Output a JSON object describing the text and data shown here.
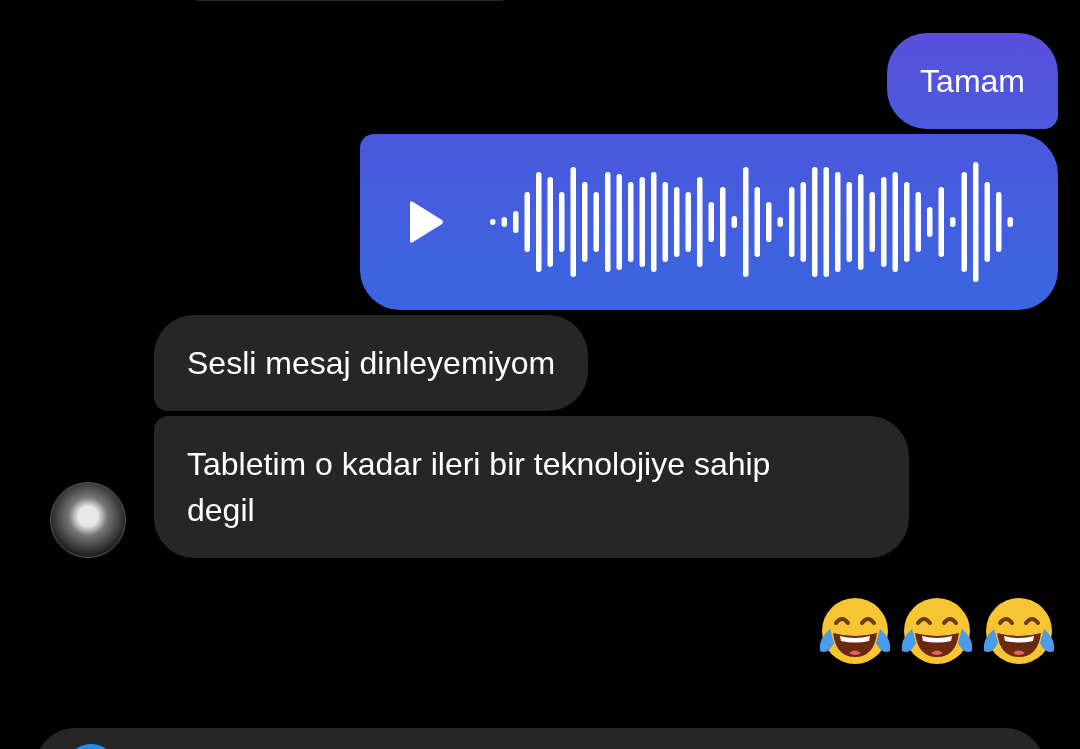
{
  "messages": [
    {
      "outgoing": true,
      "kind": "text",
      "text": "Tamam"
    },
    {
      "outgoing": true,
      "kind": "voice"
    },
    {
      "outgoing": false,
      "kind": "text",
      "text": "Sesli mesaj dinleyemiyom"
    },
    {
      "outgoing": false,
      "kind": "text",
      "text": "Tabletim o kadar ileri bir teknolojiye sahip degil",
      "avatar": true
    },
    {
      "outgoing": true,
      "kind": "emoji-row",
      "emojis": [
        {
          "kind": "tears-of-joy"
        },
        {
          "kind": "tears-of-joy"
        },
        {
          "kind": "tears-of-joy"
        }
      ]
    }
  ]
}
